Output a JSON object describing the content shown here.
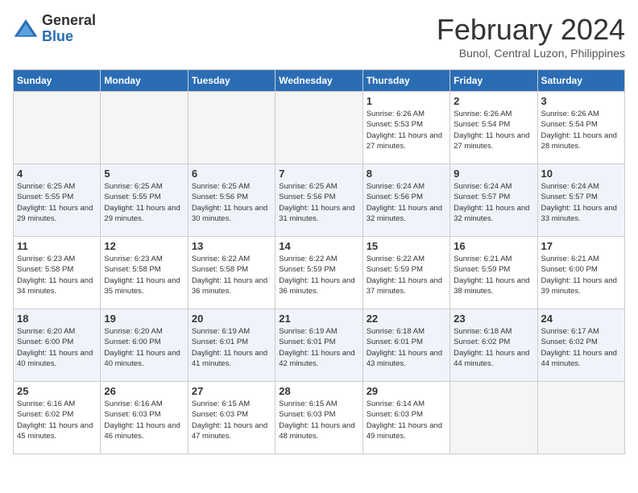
{
  "header": {
    "logo_general": "General",
    "logo_blue": "Blue",
    "title": "February 2024",
    "subtitle": "Bunol, Central Luzon, Philippines"
  },
  "days_of_week": [
    "Sunday",
    "Monday",
    "Tuesday",
    "Wednesday",
    "Thursday",
    "Friday",
    "Saturday"
  ],
  "weeks": [
    [
      {
        "day": "",
        "empty": true
      },
      {
        "day": "",
        "empty": true
      },
      {
        "day": "",
        "empty": true
      },
      {
        "day": "",
        "empty": true
      },
      {
        "day": "1",
        "sunrise": "6:26 AM",
        "sunset": "5:53 PM",
        "daylight": "11 hours and 27 minutes."
      },
      {
        "day": "2",
        "sunrise": "6:26 AM",
        "sunset": "5:54 PM",
        "daylight": "11 hours and 27 minutes."
      },
      {
        "day": "3",
        "sunrise": "6:26 AM",
        "sunset": "5:54 PM",
        "daylight": "11 hours and 28 minutes."
      }
    ],
    [
      {
        "day": "4",
        "sunrise": "6:25 AM",
        "sunset": "5:55 PM",
        "daylight": "11 hours and 29 minutes."
      },
      {
        "day": "5",
        "sunrise": "6:25 AM",
        "sunset": "5:55 PM",
        "daylight": "11 hours and 29 minutes."
      },
      {
        "day": "6",
        "sunrise": "6:25 AM",
        "sunset": "5:56 PM",
        "daylight": "11 hours and 30 minutes."
      },
      {
        "day": "7",
        "sunrise": "6:25 AM",
        "sunset": "5:56 PM",
        "daylight": "11 hours and 31 minutes."
      },
      {
        "day": "8",
        "sunrise": "6:24 AM",
        "sunset": "5:56 PM",
        "daylight": "11 hours and 32 minutes."
      },
      {
        "day": "9",
        "sunrise": "6:24 AM",
        "sunset": "5:57 PM",
        "daylight": "11 hours and 32 minutes."
      },
      {
        "day": "10",
        "sunrise": "6:24 AM",
        "sunset": "5:57 PM",
        "daylight": "11 hours and 33 minutes."
      }
    ],
    [
      {
        "day": "11",
        "sunrise": "6:23 AM",
        "sunset": "5:58 PM",
        "daylight": "11 hours and 34 minutes."
      },
      {
        "day": "12",
        "sunrise": "6:23 AM",
        "sunset": "5:58 PM",
        "daylight": "11 hours and 35 minutes."
      },
      {
        "day": "13",
        "sunrise": "6:22 AM",
        "sunset": "5:58 PM",
        "daylight": "11 hours and 36 minutes."
      },
      {
        "day": "14",
        "sunrise": "6:22 AM",
        "sunset": "5:59 PM",
        "daylight": "11 hours and 36 minutes."
      },
      {
        "day": "15",
        "sunrise": "6:22 AM",
        "sunset": "5:59 PM",
        "daylight": "11 hours and 37 minutes."
      },
      {
        "day": "16",
        "sunrise": "6:21 AM",
        "sunset": "5:59 PM",
        "daylight": "11 hours and 38 minutes."
      },
      {
        "day": "17",
        "sunrise": "6:21 AM",
        "sunset": "6:00 PM",
        "daylight": "11 hours and 39 minutes."
      }
    ],
    [
      {
        "day": "18",
        "sunrise": "6:20 AM",
        "sunset": "6:00 PM",
        "daylight": "11 hours and 40 minutes."
      },
      {
        "day": "19",
        "sunrise": "6:20 AM",
        "sunset": "6:00 PM",
        "daylight": "11 hours and 40 minutes."
      },
      {
        "day": "20",
        "sunrise": "6:19 AM",
        "sunset": "6:01 PM",
        "daylight": "11 hours and 41 minutes."
      },
      {
        "day": "21",
        "sunrise": "6:19 AM",
        "sunset": "6:01 PM",
        "daylight": "11 hours and 42 minutes."
      },
      {
        "day": "22",
        "sunrise": "6:18 AM",
        "sunset": "6:01 PM",
        "daylight": "11 hours and 43 minutes."
      },
      {
        "day": "23",
        "sunrise": "6:18 AM",
        "sunset": "6:02 PM",
        "daylight": "11 hours and 44 minutes."
      },
      {
        "day": "24",
        "sunrise": "6:17 AM",
        "sunset": "6:02 PM",
        "daylight": "11 hours and 44 minutes."
      }
    ],
    [
      {
        "day": "25",
        "sunrise": "6:16 AM",
        "sunset": "6:02 PM",
        "daylight": "11 hours and 45 minutes."
      },
      {
        "day": "26",
        "sunrise": "6:16 AM",
        "sunset": "6:03 PM",
        "daylight": "11 hours and 46 minutes."
      },
      {
        "day": "27",
        "sunrise": "6:15 AM",
        "sunset": "6:03 PM",
        "daylight": "11 hours and 47 minutes."
      },
      {
        "day": "28",
        "sunrise": "6:15 AM",
        "sunset": "6:03 PM",
        "daylight": "11 hours and 48 minutes."
      },
      {
        "day": "29",
        "sunrise": "6:14 AM",
        "sunset": "6:03 PM",
        "daylight": "11 hours and 49 minutes."
      },
      {
        "day": "",
        "empty": true
      },
      {
        "day": "",
        "empty": true
      }
    ]
  ]
}
